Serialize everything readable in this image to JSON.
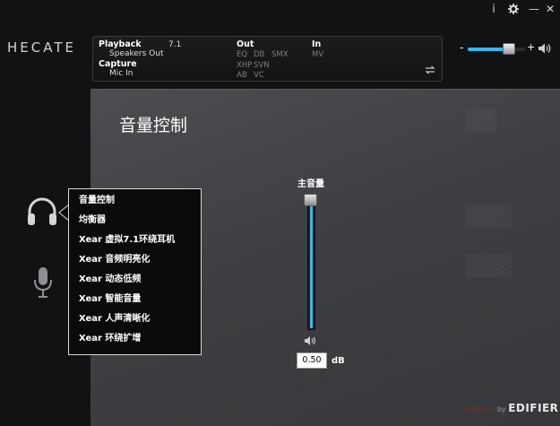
{
  "window": {
    "info_label": "i",
    "settings_icon": "gear-icon",
    "minimize_label": "—",
    "close_label": "✕"
  },
  "logo": {
    "text": "HECATE"
  },
  "status": {
    "playback_label": "Playback",
    "playback_device": "Speakers Out",
    "channel_mode": "7.1",
    "capture_label": "Capture",
    "capture_device": "Mic In",
    "out_label": "Out",
    "out_tags": [
      "EQ",
      "DB",
      "SMX",
      "XHP",
      "SVN",
      "AB",
      "VC"
    ],
    "in_label": "In",
    "in_tags": [
      "MV"
    ],
    "swap_icon": "swap-icon"
  },
  "top_volume": {
    "minus": "-",
    "plus": "+",
    "level": 0.72
  },
  "main": {
    "title": "音量控制"
  },
  "master_volume": {
    "label": "主音量",
    "value": "0.50",
    "unit": "dB",
    "level": 0.98
  },
  "menu": {
    "items": [
      "音量控制",
      "均衡器",
      "Xear 虚拟7.1环绕耳机",
      "Xear 音频明亮化",
      "Xear 动态低频",
      "Xear 智能音量",
      "Xear 人声清晰化",
      "Xear 环绕扩增"
    ]
  },
  "brand": {
    "prefix": "Dolmpia",
    "by": " by ",
    "name": "EDIFIER"
  },
  "colors": {
    "accent": "#3fb6e6",
    "background": "#111214",
    "panel": "#46474a"
  }
}
